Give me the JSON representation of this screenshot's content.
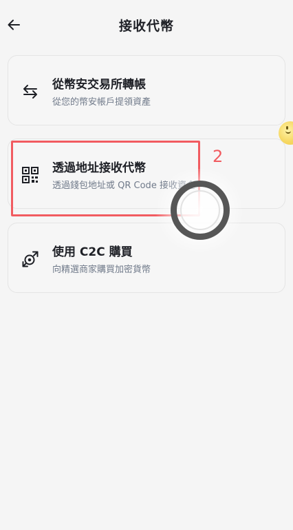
{
  "header": {
    "title": "接收代幣",
    "back_icon": "arrow-left-icon"
  },
  "options": [
    {
      "title": "從幣安交易所轉帳",
      "subtitle": "從您的幣安帳戶提領資產",
      "icon": "transfer-arrows-icon"
    },
    {
      "title": "透過地址接收代幣",
      "subtitle": "透過錢包地址或 QR Code 接收資金",
      "icon": "qr-code-icon"
    },
    {
      "title": "使用 C2C 購買",
      "subtitle": "向精選商家購買加密貨幣",
      "icon": "c2c-exchange-icon"
    }
  ],
  "annotation": {
    "label": "2",
    "color": "#f15b60"
  },
  "colors": {
    "background": "#f5f5f5",
    "card_border": "#e4e4e4",
    "subtitle_text": "#707a8a",
    "primary_text": "#1e2026"
  }
}
